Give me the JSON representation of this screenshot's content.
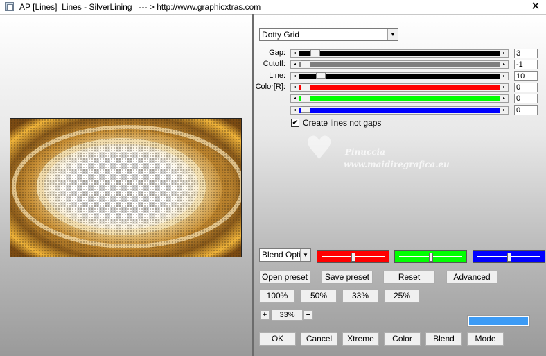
{
  "window": {
    "title": "AP [Lines]  Lines - SilverLining   --- > http://www.graphicxtras.com",
    "close_glyph": "✕"
  },
  "preset_dropdown": {
    "value": "Dotty Grid"
  },
  "sliders": [
    {
      "label": "Gap:",
      "value": "3",
      "fraction": 0.05,
      "track_color": "#000000"
    },
    {
      "label": "Cutoff:",
      "value": "-1",
      "fraction": 0.0,
      "track_color": "#808080"
    },
    {
      "label": "Line:",
      "value": "10",
      "fraction": 0.08,
      "track_color": "#000000"
    },
    {
      "label": "Color[R]:",
      "value": "0",
      "fraction": 0.0,
      "track_color": "#ff0000"
    },
    {
      "label": "",
      "value": "0",
      "fraction": 0.0,
      "track_color": "#00ff00"
    },
    {
      "label": "",
      "value": "0",
      "fraction": 0.0,
      "track_color": "#0000ff"
    }
  ],
  "checkbox": {
    "label": "Create lines not gaps",
    "checked": true,
    "mark": "✔"
  },
  "watermark": {
    "line1": "Pinuccia",
    "line2": "www.maidiregrafica.eu",
    "icon": "heart-icon"
  },
  "blend_dropdown": {
    "value": "Blend Optio"
  },
  "color_swatches": [
    {
      "name": "red",
      "color": "#ff0000",
      "fraction": 0.5
    },
    {
      "name": "green",
      "color": "#00ff00",
      "fraction": 0.5
    },
    {
      "name": "blue",
      "color": "#0000ff",
      "fraction": 0.5
    }
  ],
  "preset_buttons": {
    "open": "Open preset",
    "save": "Save preset",
    "reset": "Reset",
    "advanced": "Advanced"
  },
  "zoom_buttons": {
    "z100": "100%",
    "z50": "50%",
    "z33": "33%",
    "z25": "25%"
  },
  "zoom_control": {
    "plus": "+",
    "value": "33%",
    "minus": "−"
  },
  "bottom_buttons": {
    "ok": "OK",
    "cancel": "Cancel",
    "xtreme": "Xtreme",
    "color": "Color",
    "blend": "Blend",
    "mode": "Mode"
  },
  "colors": {
    "accent_bar": "#3c9bf5",
    "gold": "#d9a53a"
  }
}
